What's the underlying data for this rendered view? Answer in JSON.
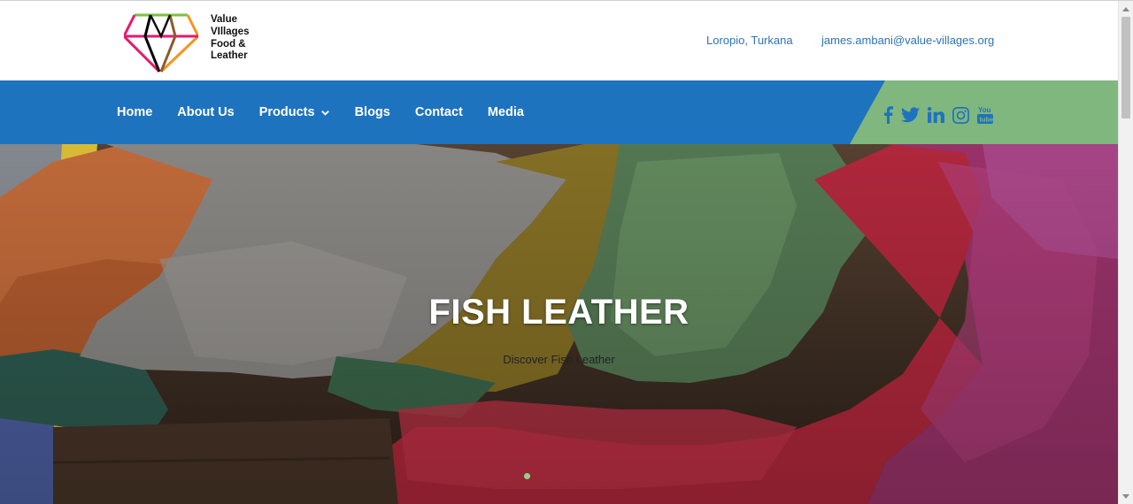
{
  "brand": {
    "logo_lines": [
      "Value",
      "VIllages",
      "Food &",
      "Leather"
    ],
    "logo_colors": [
      "#e8176f",
      "#f7941d",
      "#000000",
      "#7ac143"
    ]
  },
  "contact": {
    "location": "Loropio, Turkana",
    "email": "james.ambani@value-villages.org"
  },
  "nav": {
    "items": [
      {
        "label": "Home"
      },
      {
        "label": "About Us"
      },
      {
        "label": "Products",
        "has_dropdown": true
      },
      {
        "label": "Blogs"
      },
      {
        "label": "Contact"
      },
      {
        "label": "Media"
      }
    ]
  },
  "social": {
    "icons": [
      "facebook-icon",
      "twitter-icon",
      "linkedin-icon",
      "instagram-icon",
      "youtube-icon"
    ]
  },
  "hero": {
    "title": "FISH LEATHER",
    "subtitle": "Discover Fish Leather",
    "slide_count_visible": 1,
    "active_slide": 1
  },
  "colors": {
    "nav_blue": "#1e73be",
    "social_green": "#7fb77e",
    "link_blue": "#2b74b9",
    "slider_dot": "#8fd18d"
  }
}
